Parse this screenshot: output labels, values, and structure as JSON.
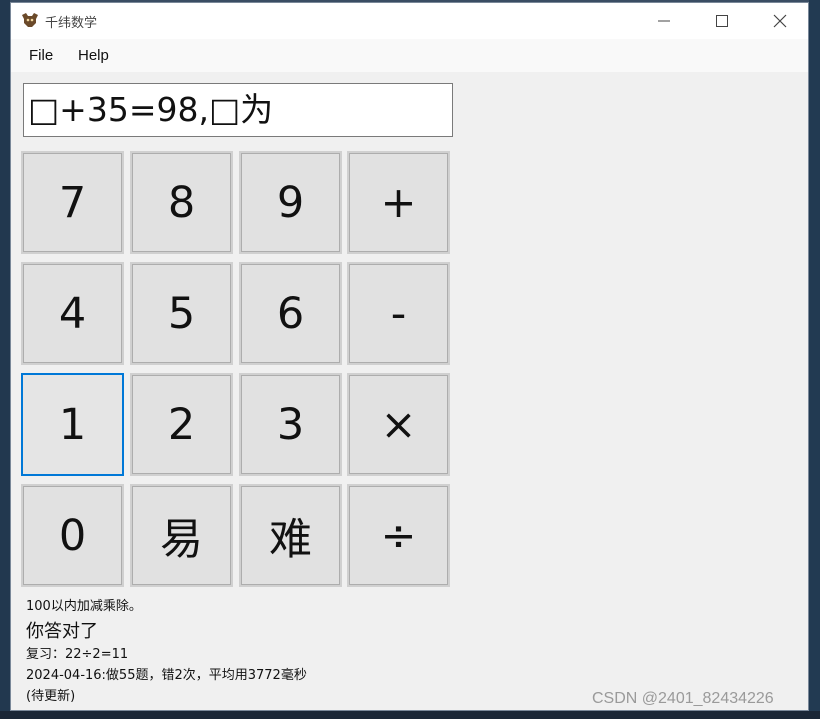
{
  "window": {
    "title": "千纬数学",
    "controls": {
      "minimize": "—",
      "maximize": "☐",
      "close": "✕"
    }
  },
  "menu": {
    "items": [
      "File",
      "Help"
    ]
  },
  "display": {
    "text": "□+35=98,□为"
  },
  "keypad": {
    "keys": [
      "7",
      "8",
      "9",
      "+",
      "4",
      "5",
      "6",
      "-",
      "1",
      "2",
      "3",
      "×",
      "0",
      "易",
      "难",
      "÷"
    ],
    "focused_key": "1"
  },
  "info": {
    "scope": "100以内加减乘除。",
    "result": "你答对了",
    "review": "复习：22÷2=11",
    "stats": "2024-04-16:做55题，错2次，平均用3772毫秒",
    "pending": "(待更新)"
  },
  "watermark": "CSDN @2401_82434226",
  "colors": {
    "focus_border": "#0078d7",
    "key_bg": "#e1e1e1",
    "window_bg": "#f0f0f0"
  }
}
